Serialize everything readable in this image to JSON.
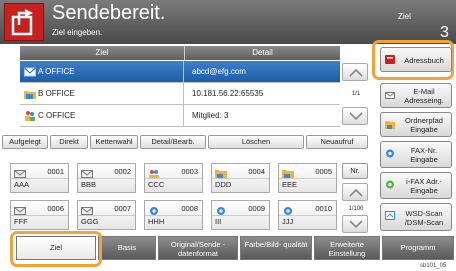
{
  "header": {
    "title": "Sendebereit.",
    "subtitle": "Ziel eingeben.",
    "right_label": "Ziel",
    "count": "3"
  },
  "table": {
    "col_dest": "Ziel",
    "col_detail": "Detail",
    "rows": [
      {
        "name": "A OFFICE",
        "detail": "abcd@efg.com",
        "selected": true,
        "icon": "email-icon"
      },
      {
        "name": "B OFFICE",
        "detail": "10.181.56.22:65535",
        "selected": false,
        "icon": "folder-icon"
      },
      {
        "name": "C OFFICE",
        "detail": "Mitglied:    3",
        "selected": false,
        "icon": "group-icon"
      }
    ],
    "page": "1/1"
  },
  "toolbar": [
    "Aufgelegt",
    "Direkt",
    "Kettenwahl",
    "Detail/Bearb.",
    "Löschen",
    "Neuaufruf"
  ],
  "onetouch": {
    "page": "1/100",
    "nr_label": "Nr.",
    "keys": [
      {
        "num": "0001",
        "name": "AAA"
      },
      {
        "num": "0002",
        "name": "BBB"
      },
      {
        "num": "0003",
        "name": "CCC"
      },
      {
        "num": "0004",
        "name": "DDD"
      },
      {
        "num": "0005",
        "name": "EEE"
      },
      {
        "num": "0006",
        "name": "FFF"
      },
      {
        "num": "0007",
        "name": "GGG"
      },
      {
        "num": "0008",
        "name": "HHH"
      },
      {
        "num": "0009",
        "name": "III"
      },
      {
        "num": "0010",
        "name": "JJJ"
      }
    ]
  },
  "side": {
    "adressbuch": "Adressbuch",
    "email": "E-Mail Adresseing.",
    "ordner": "Ordnerpfad Eingabe",
    "fax": "FAX-Nr. Eingabe",
    "ifax": "i-FAX Adr.-Eingabe",
    "wsd": "WSD-Scan /DSM-Scan"
  },
  "tabs": [
    "Ziel",
    "Basis",
    "Original/Sende -datenformat",
    "Farbe/Bild- qualität",
    "Erweiterte Einstellung",
    "Programm"
  ],
  "footer_code": "sb101_05",
  "colors": {
    "accent": "#f2a23a",
    "selection": "#1c5ea8",
    "logo": "#c8201f"
  }
}
